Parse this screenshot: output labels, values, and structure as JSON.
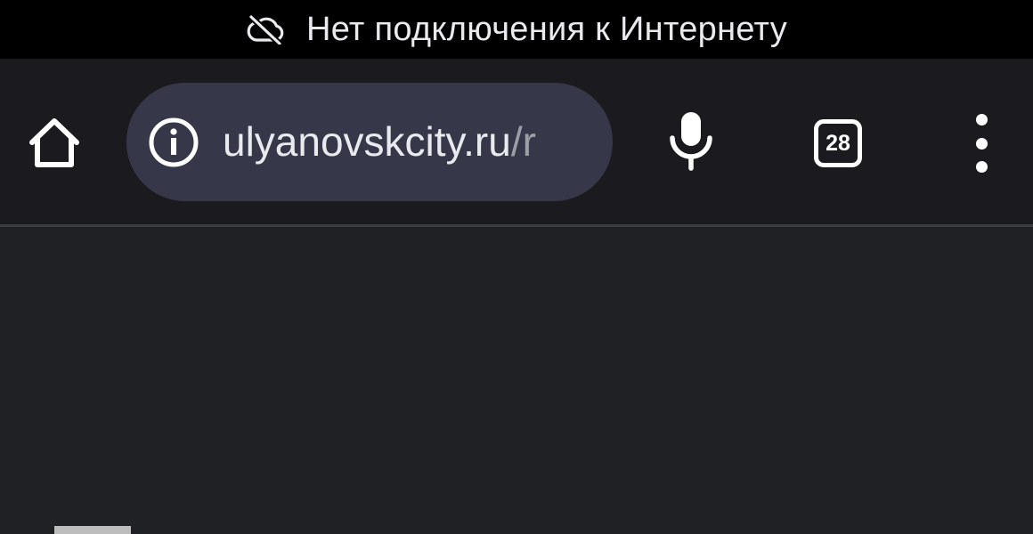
{
  "status_bar": {
    "message": "Нет подключения к Интернету",
    "icon": "cloud-off-icon"
  },
  "toolbar": {
    "home_icon": "home-icon",
    "omnibox": {
      "security_icon": "info-icon",
      "host": "ulyanovskcity.ru",
      "path": "/r"
    },
    "mic_icon": "microphone-icon",
    "tab_count": "28",
    "menu_icon": "more-vert-icon"
  },
  "colors": {
    "status_bar_bg": "#000000",
    "toolbar_bg": "#1b1b1f",
    "omnibox_bg": "#36384a",
    "content_bg": "#202124",
    "text_primary": "#e8eaed",
    "text_secondary": "#9aa0a6"
  }
}
